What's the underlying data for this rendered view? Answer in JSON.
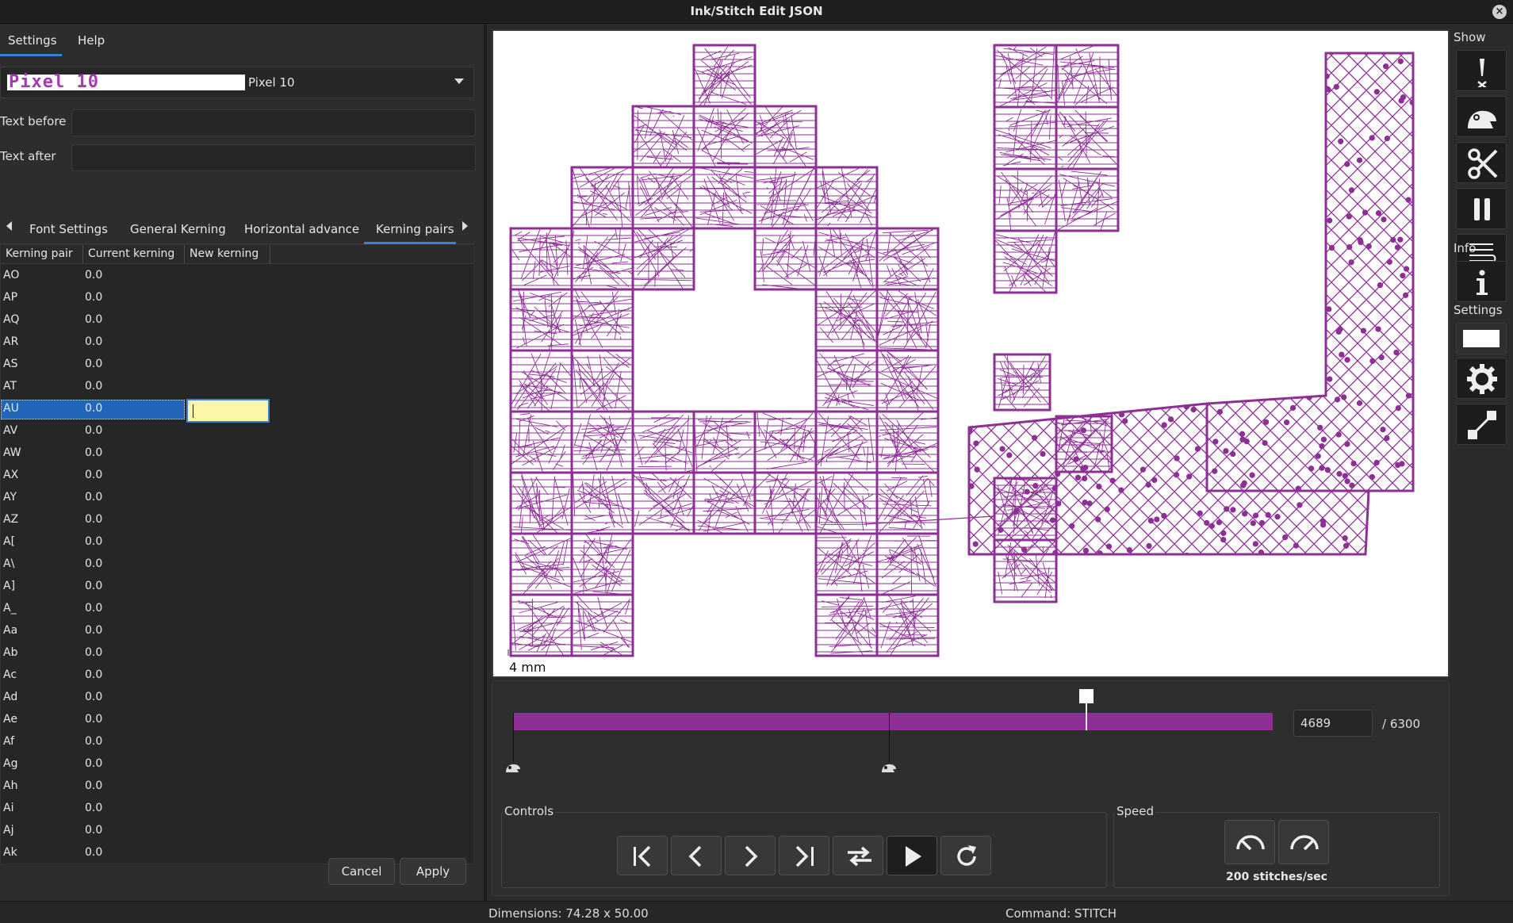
{
  "window": {
    "title": "Ink/Stitch Edit JSON",
    "close_glyph": "×"
  },
  "menu": {
    "tabs": [
      "Settings",
      "Help"
    ],
    "active": "Settings"
  },
  "font_select": {
    "preview_text": "Pixel 10",
    "name": "Pixel 10"
  },
  "fields": {
    "text_before_label": "Text before",
    "text_before_value": "",
    "text_after_label": "Text after",
    "text_after_value": ""
  },
  "subtabs": {
    "items": [
      "Font Settings",
      "General Kerning",
      "Horizontal advance",
      "Kerning pairs"
    ],
    "active": "Kerning pairs"
  },
  "kerning_table": {
    "headers": [
      "Kerning pair",
      "Current kerning",
      "New kerning"
    ],
    "rows": [
      {
        "pair": "AO",
        "current": "0.0"
      },
      {
        "pair": "AP",
        "current": "0.0"
      },
      {
        "pair": "AQ",
        "current": "0.0"
      },
      {
        "pair": "AR",
        "current": "0.0"
      },
      {
        "pair": "AS",
        "current": "0.0"
      },
      {
        "pair": "AT",
        "current": "0.0"
      },
      {
        "pair": "AU",
        "current": "0.0"
      },
      {
        "pair": "AV",
        "current": "0.0"
      },
      {
        "pair": "AW",
        "current": "0.0"
      },
      {
        "pair": "AX",
        "current": "0.0"
      },
      {
        "pair": "AY",
        "current": "0.0"
      },
      {
        "pair": "AZ",
        "current": "0.0"
      },
      {
        "pair": "A[",
        "current": "0.0"
      },
      {
        "pair": "A\\",
        "current": "0.0"
      },
      {
        "pair": "A]",
        "current": "0.0"
      },
      {
        "pair": "A_",
        "current": "0.0"
      },
      {
        "pair": "Aa",
        "current": "0.0"
      },
      {
        "pair": "Ab",
        "current": "0.0"
      },
      {
        "pair": "Ac",
        "current": "0.0"
      },
      {
        "pair": "Ad",
        "current": "0.0"
      },
      {
        "pair": "Ae",
        "current": "0.0"
      },
      {
        "pair": "Af",
        "current": "0.0"
      },
      {
        "pair": "Ag",
        "current": "0.0"
      },
      {
        "pair": "Ah",
        "current": "0.0"
      },
      {
        "pair": "Ai",
        "current": "0.0"
      },
      {
        "pair": "Aj",
        "current": "0.0"
      },
      {
        "pair": "Ak",
        "current": "0.0"
      }
    ],
    "selected_pair": "AU",
    "edit_value": ""
  },
  "buttons": {
    "cancel": "Cancel",
    "apply": "Apply"
  },
  "canvas": {
    "scale_label": "4 mm",
    "stitch_color": "#8e2f96"
  },
  "timeline": {
    "current_stitch": "4689",
    "total": "/ 6300",
    "progress_fraction": 0.744
  },
  "controls": {
    "label": "Controls",
    "buttons": [
      "jump-to-start-icon",
      "step-back-icon",
      "step-forward-icon",
      "jump-to-end-icon",
      "swap-direction-icon",
      "play-icon",
      "restart-icon"
    ]
  },
  "speed": {
    "label": "Speed",
    "value_text": "200 stitches/sec"
  },
  "sidebar": {
    "show_label": "Show",
    "info_label": "Info",
    "settings_label": "Settings"
  },
  "status": {
    "dimensions": "Dimensions: 74.28 x 50.00",
    "command": "Command: STITCH"
  },
  "colors": {
    "accent": "#3d7fd6",
    "selection": "#2166b8",
    "edit_bg": "#fbf7a8",
    "stitch": "#8e2f96"
  }
}
